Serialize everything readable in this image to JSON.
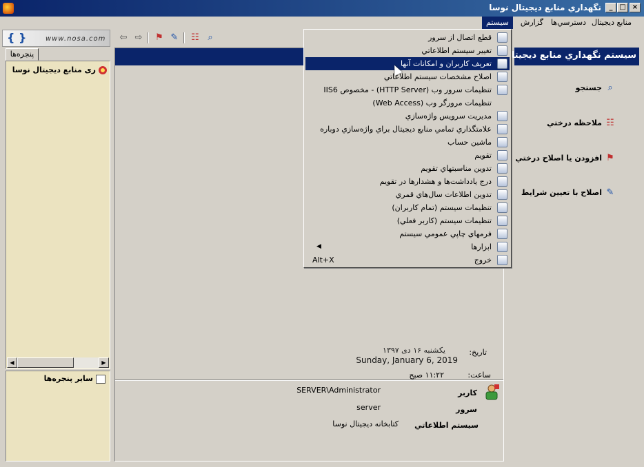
{
  "window": {
    "title": "نگهداري منابع ديجيتال نوسا"
  },
  "menubar": {
    "items": [
      {
        "label": "منابع ديجيتال"
      },
      {
        "label": "دسترسي‌ها"
      },
      {
        "label": "گزارش"
      },
      {
        "label": "سيستم"
      }
    ]
  },
  "logo": {
    "site": "www.nosa.com"
  },
  "left_panel": {
    "tab_label": "پنجره‌ها",
    "tree_root": "ری منابع ديجيتال نوسا",
    "other_windows": "ساير پنجره‌ها"
  },
  "dropdown": {
    "items": [
      {
        "label": "قطع اتصال از سرور"
      },
      {
        "label": "تغيير سيستم اطلاعاتي"
      },
      {
        "label": "تعريف كاربران و امكانات آنها"
      },
      {
        "label": "اصلاح مشخصات سيستم اطلاعاتي"
      },
      {
        "label": "تنظيمات سرور وب (HTTP Server) - مخصوص IIS6"
      },
      {
        "label": "تنظيمات مرورگر وب (Web Access)"
      },
      {
        "label": "مديريت سرويس واژه‌سازي"
      },
      {
        "label": "علامتگذاري تمامي منابع ديجيتال براي واژه‌سازي دوباره"
      },
      {
        "label": "ماشين حساب"
      },
      {
        "label": "تقويم"
      },
      {
        "label": "تدوين مناسبتهاي تقويم"
      },
      {
        "label": "درج يادداشت‌ها و هشدارها در تقويم"
      },
      {
        "label": "تدوين اطلاعات سال‌هاي قمري"
      },
      {
        "label": "تنظيمات سيستم (تمام كاربران)"
      },
      {
        "label": "تنظيمات سيستم (كاربر فعلي)"
      },
      {
        "label": "فرمهاي چاپي عمومي سيستم"
      },
      {
        "label": "ابزارها"
      },
      {
        "label": "خروج",
        "shortcut": "Alt+X"
      }
    ]
  },
  "main": {
    "date_label": "تاريخ:",
    "date_fa": "يكشنبه ۱۶ دی ۱۳۹۷",
    "date_en": "Sunday, January 6, 2019",
    "time_label": "ساعت:",
    "time_val": "۱۱:۲۲ صبح",
    "user_label": "كاربر",
    "user_val": "SERVER\\Administrator",
    "server_label": "سرور",
    "server_val": "server",
    "system_label": "سيستم اطلاعاتي",
    "system_val": "كتابخانه ديجيتال نوسا"
  },
  "right_panel": {
    "title": "سيستم نگهداري منابع ديجيتال",
    "actions": [
      {
        "label": "جستجو"
      },
      {
        "label": "ملاحظه درختي"
      },
      {
        "label": "افزودن يا اصلاح درختي"
      },
      {
        "label": "اصلاح با تعيين شرايط"
      }
    ]
  }
}
